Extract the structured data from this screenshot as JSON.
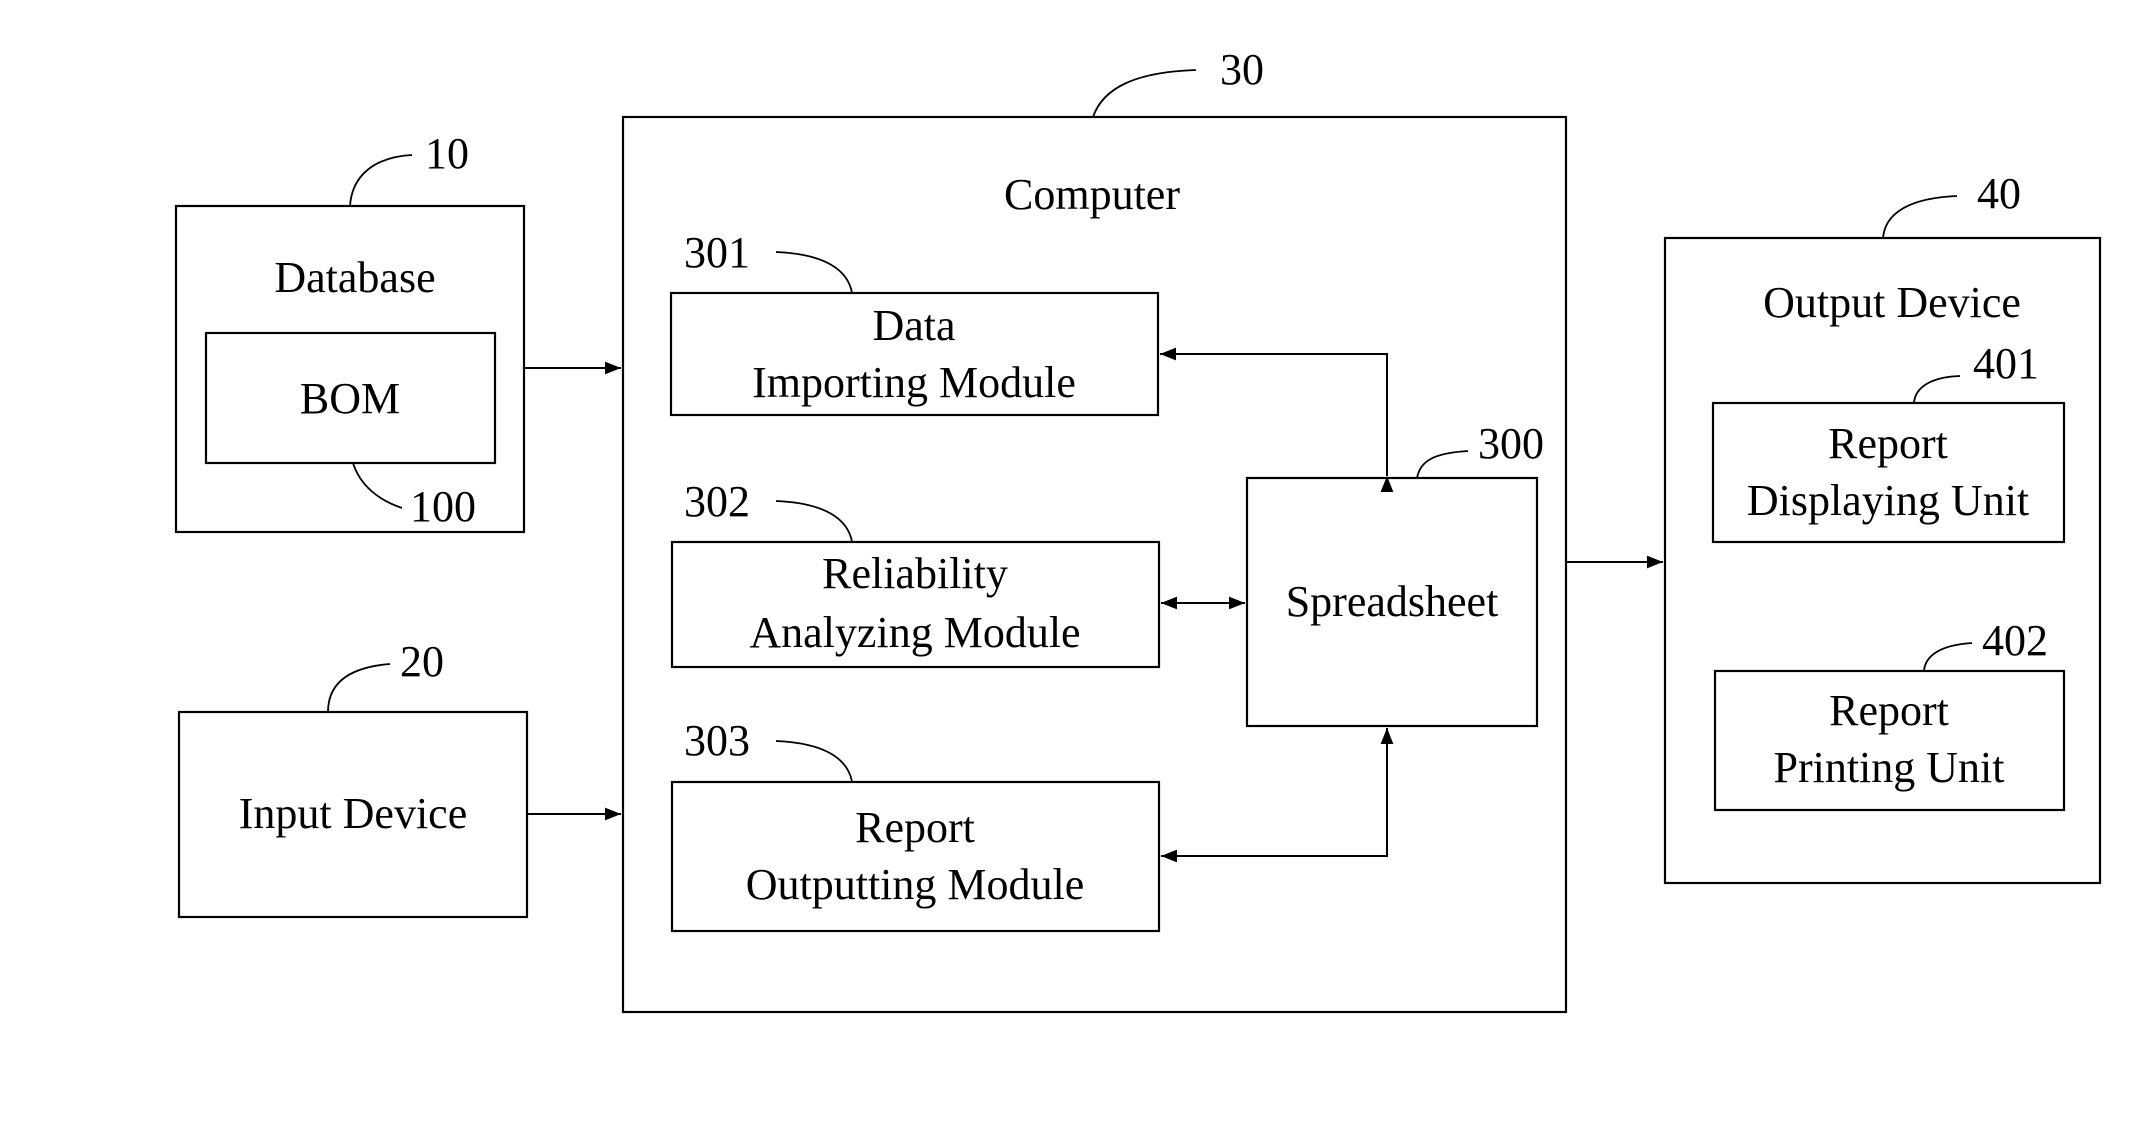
{
  "diagram": {
    "database": {
      "ref": "10",
      "label": "Database",
      "bom": {
        "ref": "100",
        "label": "BOM"
      }
    },
    "input_device": {
      "ref": "20",
      "label": "Input Device"
    },
    "computer": {
      "ref": "30",
      "label": "Computer",
      "spreadsheet": {
        "ref": "300",
        "label": "Spreadsheet"
      },
      "modules": [
        {
          "ref": "301",
          "lines": [
            "Data",
            "Importing Module"
          ]
        },
        {
          "ref": "302",
          "lines": [
            "Reliability",
            "Analyzing Module"
          ]
        },
        {
          "ref": "303",
          "lines": [
            "Report",
            "Outputting Module"
          ]
        }
      ]
    },
    "output_device": {
      "ref": "40",
      "label": "Output Device",
      "units": [
        {
          "ref": "401",
          "lines": [
            "Report",
            "Displaying Unit"
          ]
        },
        {
          "ref": "402",
          "lines": [
            "Report",
            "Printing Unit"
          ]
        }
      ]
    },
    "connections": [
      {
        "from": "Database",
        "to": "Computer",
        "direction": "one-way"
      },
      {
        "from": "Input Device",
        "to": "Computer",
        "direction": "one-way"
      },
      {
        "from": "Data Importing Module",
        "to": "Spreadsheet",
        "direction": "two-way"
      },
      {
        "from": "Reliability Analyzing Module",
        "to": "Spreadsheet",
        "direction": "two-way"
      },
      {
        "from": "Report Outputting Module",
        "to": "Spreadsheet",
        "direction": "two-way"
      },
      {
        "from": "Computer",
        "to": "Output Device",
        "direction": "one-way"
      }
    ]
  }
}
